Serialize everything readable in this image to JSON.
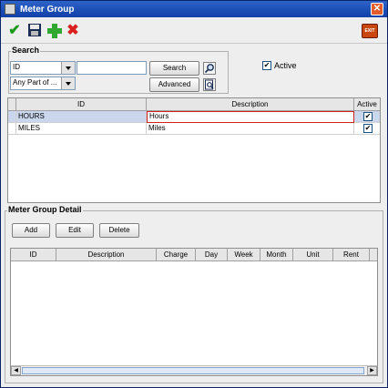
{
  "window": {
    "title": "Meter Group",
    "close_glyph": "✕"
  },
  "toolbar": {
    "ok_icon": "checkmark-icon",
    "save_icon": "save-icon",
    "add_icon": "plus-icon",
    "delete_icon": "delete-x-icon",
    "exit_label": "EXIT",
    "colors": {
      "ok": "#1a9a1a",
      "add": "#2fa82f",
      "delete": "#d92020"
    }
  },
  "search": {
    "legend": "Search",
    "field_select": "ID",
    "match_select": "Any Part of ...",
    "query_value": "",
    "search_button": "Search",
    "advanced_button": "Advanced",
    "active_label": "Active",
    "active_checked": true
  },
  "grid": {
    "columns": [
      "ID",
      "Description",
      "Active"
    ],
    "rows": [
      {
        "id": "HOURS",
        "description": "Hours",
        "active": true,
        "selected": true
      },
      {
        "id": "MILES",
        "description": "Miles",
        "active": true,
        "selected": false
      }
    ]
  },
  "detail": {
    "legend": "Meter Group Detail",
    "add_button": "Add",
    "edit_button": "Edit",
    "delete_button": "Delete",
    "columns": [
      "ID",
      "Description",
      "Charge",
      "Day",
      "Week",
      "Month",
      "Unit",
      "Rent"
    ]
  },
  "check_glyph": "✔"
}
